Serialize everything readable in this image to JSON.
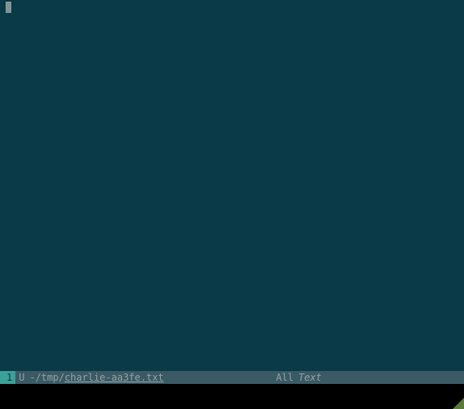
{
  "editor": {
    "content": ""
  },
  "statusline": {
    "line_number": "1",
    "modified_flag": "U",
    "path_prefix": "-/tmp/",
    "filename": "charlie-aa3fe.txt",
    "position": "All",
    "mode": "Text"
  },
  "commandline": {
    "content": ""
  }
}
